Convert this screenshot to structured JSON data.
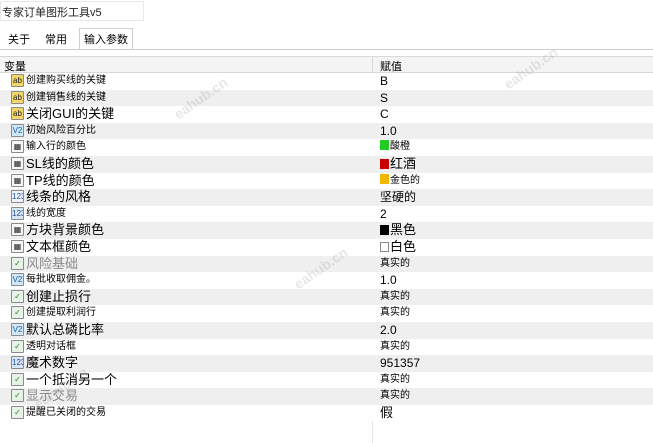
{
  "window": {
    "title": "专家订单图形工具v5"
  },
  "tabs": [
    {
      "label": "关于"
    },
    {
      "label": "常用"
    },
    {
      "label": "输入参数"
    }
  ],
  "grid": {
    "columns": {
      "variable": "变量",
      "value": "赋值"
    },
    "rows": [
      {
        "icon": "ab",
        "name": "创建购买线的关键",
        "value": "B"
      },
      {
        "icon": "ab",
        "name": "创建销售线的关键",
        "value": "S"
      },
      {
        "icon": "ab",
        "name": "关闭GUI的关键",
        "value": "C"
      },
      {
        "icon": "v2",
        "name": "初始风险百分比",
        "value": "1.0"
      },
      {
        "icon": "clr",
        "name": "输入行的颜色",
        "value": "酸橙",
        "swatch": "#22cc22"
      },
      {
        "icon": "clr",
        "name": "SL线的颜色",
        "value": "红酒",
        "swatch": "#cc0000"
      },
      {
        "icon": "clr",
        "name": "TP线的颜色",
        "value": "金色的",
        "swatch": "#f2b800"
      },
      {
        "icon": "enum",
        "name": "线条的风格",
        "value": "坚硬的"
      },
      {
        "icon": "num",
        "name": "线的宽度",
        "value": "2"
      },
      {
        "icon": "clr",
        "name": "方块背景颜色",
        "value": "黑色",
        "swatch": "#000000"
      },
      {
        "icon": "clr",
        "name": "文本框颜色",
        "value": "白色",
        "swatch": "#ffffff"
      },
      {
        "icon": "bool",
        "name": "风险基础",
        "value": "真实的"
      },
      {
        "icon": "v2",
        "name": "每批收取佣金。",
        "value": "1.0"
      },
      {
        "icon": "bool",
        "name": "创建止损行",
        "value": "真实的"
      },
      {
        "icon": "bool",
        "name": "创建提取利润行",
        "value": "真实的"
      },
      {
        "icon": "v2",
        "name": "默认总磷比率",
        "value": "2.0"
      },
      {
        "icon": "bool",
        "name": "透明对话框",
        "value": "真实的"
      },
      {
        "icon": "num",
        "name": "魔术数字",
        "value": "951357"
      },
      {
        "icon": "bool",
        "name": "一个抵消另一个",
        "value": "真实的"
      },
      {
        "icon": "bool",
        "name": "显示交易",
        "value": "真实的"
      },
      {
        "icon": "bool",
        "name": "提醒已关闭的交易",
        "value": "假"
      }
    ]
  },
  "watermarks": [
    "eahub.cn"
  ]
}
